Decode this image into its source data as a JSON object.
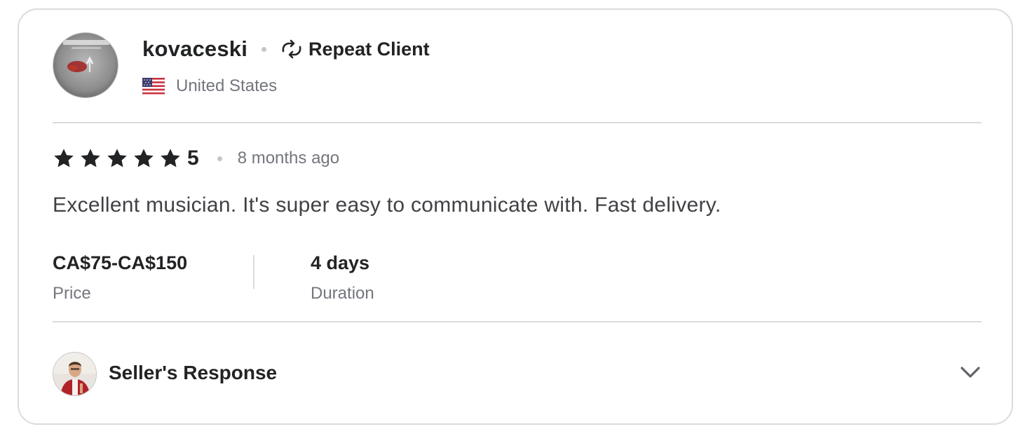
{
  "reviewer": {
    "username": "kovaceski",
    "badge_label": "Repeat Client",
    "badge_icon": "repeat-icon",
    "country": "United States",
    "flag_icon": "us-flag-icon",
    "avatar_icon": "avatar-icon"
  },
  "rating": {
    "stars": 5,
    "max_stars": 5,
    "value": "5",
    "time_ago": "8 months ago",
    "star_icon": "star-icon"
  },
  "review": {
    "text": "Excellent musician. It's super easy to communicate with. Fast delivery."
  },
  "details": {
    "price_value": "CA$75-CA$150",
    "price_label": "Price",
    "duration_value": "4 days",
    "duration_label": "Duration"
  },
  "seller_response": {
    "label": "Seller's Response",
    "avatar_icon": "seller-avatar-icon",
    "toggle_icon": "chevron-down-icon"
  },
  "colors": {
    "text_primary": "#222325",
    "text_secondary": "#74767e",
    "border": "#dadbdd",
    "star": "#222325"
  }
}
